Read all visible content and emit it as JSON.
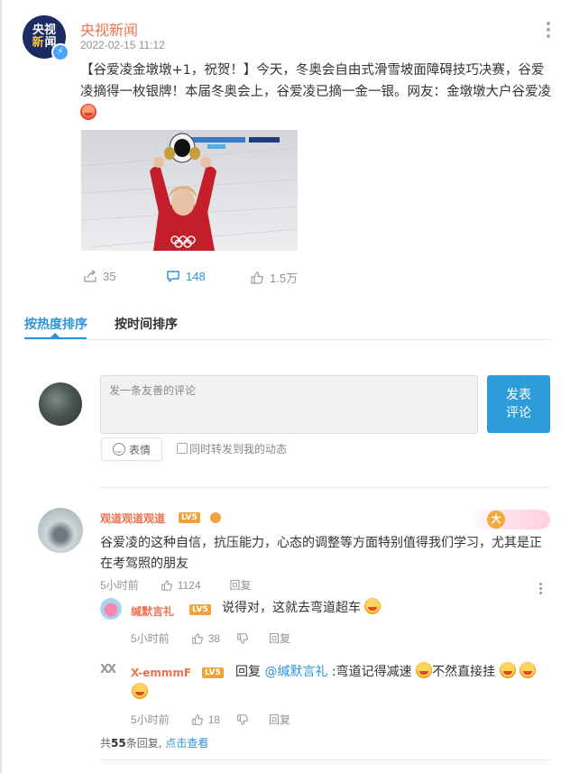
{
  "post": {
    "author": "央视新闻",
    "avatar_text_top": "央视",
    "avatar_text_bottom_a": "新",
    "avatar_text_bottom_b": "闻",
    "time": "2022-02-15 11:12",
    "text": "【谷爱凌金墩墩+1，祝贺！】今天，冬奥会自由式滑雪坡面障碍技巧决赛，谷爱凌摘得一枚银牌！本届冬奥会上，谷爱凌已摘一金一银。网友：金墩墩大户谷爱凌",
    "actions": {
      "repost": "35",
      "comment": "148",
      "like": "1.5万"
    }
  },
  "tabs": [
    {
      "label": "按热度排序",
      "active": true
    },
    {
      "label": "按时间排序",
      "active": false
    }
  ],
  "composer": {
    "placeholder": "发一条友善的评论",
    "send_line1": "发表",
    "send_line2": "评论",
    "emoji_label": "表情",
    "repost_label": "同时转发到我的动态"
  },
  "comments": [
    {
      "user": "观道观道观道",
      "level": "LV5",
      "badge": "大",
      "text": "谷爱凌的这种自信，抗压能力，心态的调整等方面特别值得我们学习，尤其是正在考驾照的朋友",
      "time": "5小时前",
      "likes": "1124",
      "reply_label": "回复",
      "replies": [
        {
          "user": "缄默言礼",
          "level": "LV5",
          "text": "说得对，这就去弯道超车",
          "time": "5小时前",
          "likes": "38",
          "reply_label": "回复"
        },
        {
          "user": "X-emmmF",
          "level": "LV5",
          "prefix": "回复 ",
          "mention": "@缄默言礼",
          "text_a": ":弯道记得减速",
          "text_b": "不然直接挂",
          "time": "5小时前",
          "likes": "18",
          "reply_label": "回复"
        }
      ],
      "reply_summary_pre": "共",
      "reply_count": "55",
      "reply_summary_post": "条回复,",
      "view_link": "点击查看"
    }
  ],
  "colors": {
    "accent": "#2c94d8",
    "author": "#eb7350",
    "level": "#f0a23c"
  }
}
